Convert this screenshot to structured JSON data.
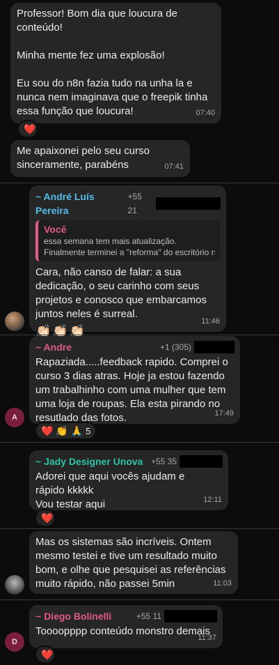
{
  "colors": {
    "background": "#0c0c0c",
    "bubble": "#262626",
    "name_andre_luis": "#53bdeb",
    "name_andre": "#e05a8a",
    "name_jady": "#2ec4a4",
    "name_diego": "#e05a8a"
  },
  "messages": [
    {
      "text": "Professor! Bom dia que loucura de conteúdo!\n\nMinha mente fez uma explosão!\n\nEu sou do n8n fazia tudo na unha la e nunca nem imaginava que o freepik tinha essa função que loucura!",
      "time": "07:40",
      "reactions": "❤️"
    },
    {
      "text": "Me apaixonei pelo seu curso sinceramente, parabéns",
      "time": "07:41"
    },
    {
      "sender": "~ André Luís Pereira",
      "phone": "+55 21",
      "quote_author": "Você",
      "quote_line1": "essa semana tem mais atualização.",
      "quote_line2": "Finalmente terminei a \"reforma\" do escritório rs",
      "text": "Cara, não canso de falar: a sua dedicação, o seu carinho com seus projetos e conosco que embarcamos juntos neles é surreal.",
      "emojis": "👏🏻👏🏻👏🏻",
      "time": "11:46"
    },
    {
      "sender": "~ Andre",
      "phone": "+1 (305)",
      "avatar": "A",
      "text": "Rapaziada.....feedback rapido. Comprei o curso 3 dias atras. Hoje ja estou fazendo um trabalhinho com uma mulher que tem uma loja de roupas. Ela esta pirando no resutlado das fotos.",
      "time": "17:49",
      "reactions": "❤️ 👏 🙏",
      "reaction_count": "5"
    },
    {
      "sender": "~ Jady Designer Unova",
      "phone": "+55 35",
      "text": "Adorei que aqui vocês ajudam e rápido kkkkk\nVou testar aqui",
      "time": "12:11",
      "reactions": "❤️"
    },
    {
      "text": "Mas os sistemas são incríveis. Ontem mesmo testei e tive um resultado muito bom, e olhe que pesquisei as referências muito rápido, não passei 5min",
      "time": "11:03"
    },
    {
      "sender": "~ Diego Bolinelli",
      "phone": "+55 11",
      "avatar": "D",
      "text": "Toooopppp conteúdo monstro demais",
      "time": "11:37",
      "reactions": "❤️"
    }
  ]
}
